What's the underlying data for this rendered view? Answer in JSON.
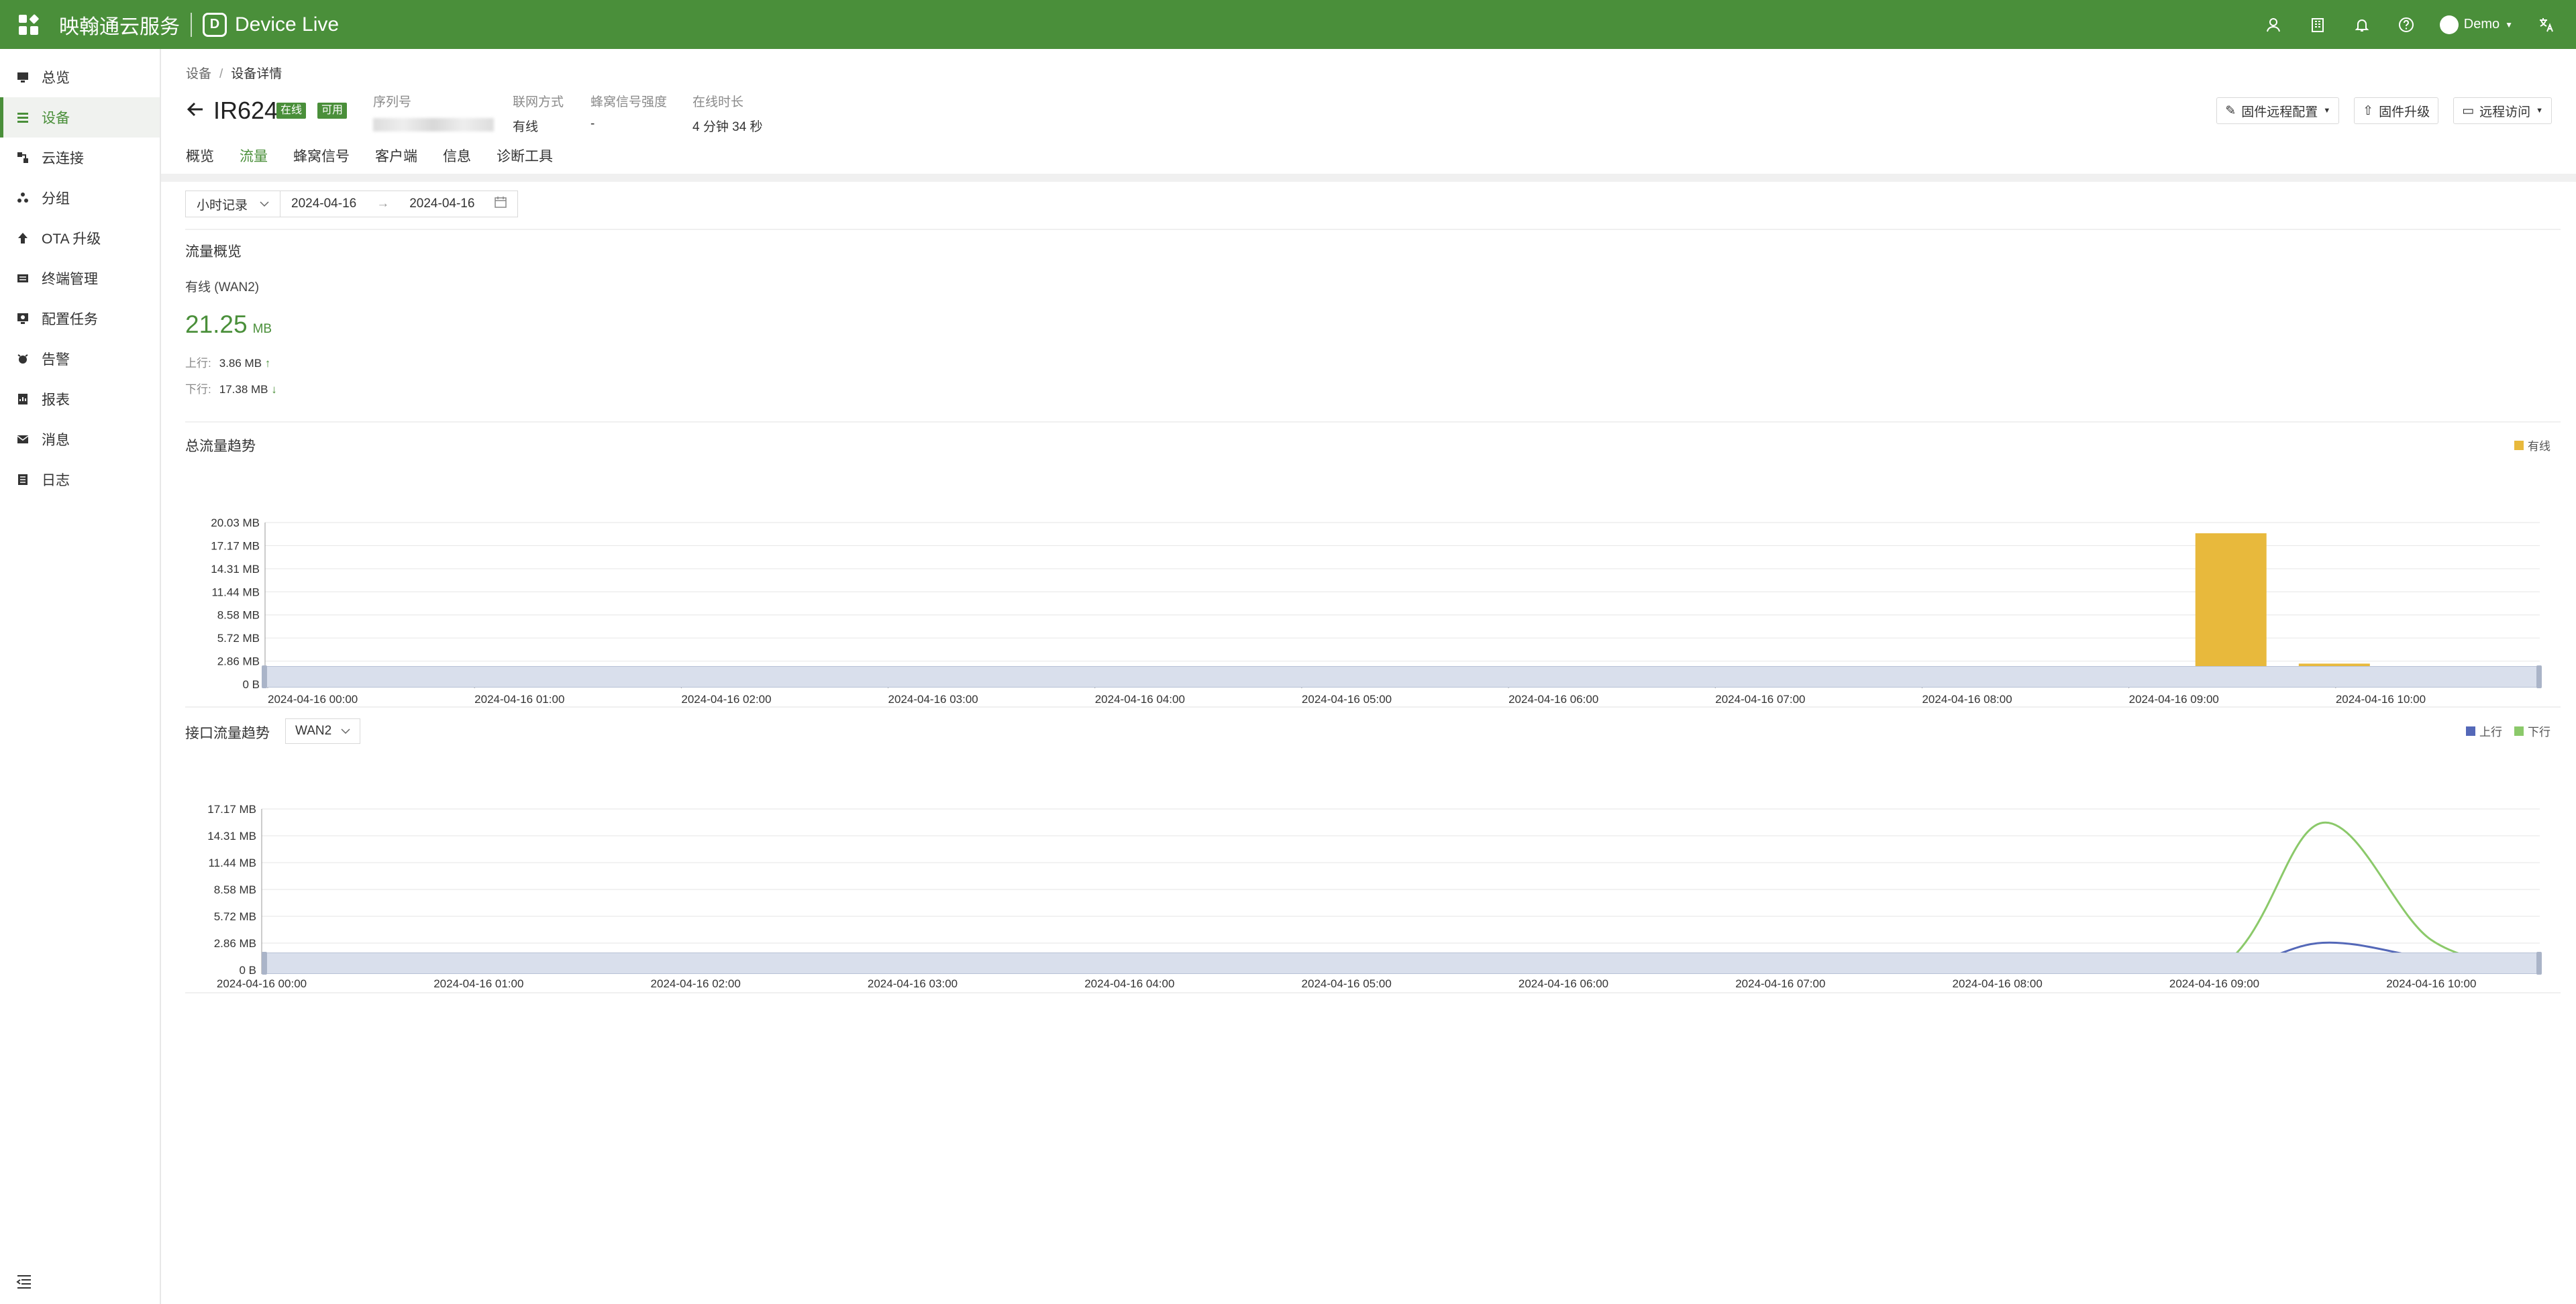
{
  "topbar": {
    "brand": "映翰通云服务",
    "product_logo": "D",
    "product_name": "Device Live",
    "user": "Demo",
    "icons": [
      "user-icon",
      "building-icon",
      "bell-icon",
      "help-icon",
      "translate-icon"
    ]
  },
  "sidebar": {
    "items": [
      {
        "label": "总览",
        "icon": "dashboard-icon"
      },
      {
        "label": "设备",
        "icon": "list-icon",
        "active": true
      },
      {
        "label": "云连接",
        "icon": "connection-icon"
      },
      {
        "label": "分组",
        "icon": "group-icon"
      },
      {
        "label": "OTA 升级",
        "icon": "upload-icon"
      },
      {
        "label": "终端管理",
        "icon": "terminal-icon"
      },
      {
        "label": "配置任务",
        "icon": "config-icon"
      },
      {
        "label": "告警",
        "icon": "alarm-icon"
      },
      {
        "label": "报表",
        "icon": "report-icon"
      },
      {
        "label": "消息",
        "icon": "message-icon"
      },
      {
        "label": "日志",
        "icon": "log-icon"
      }
    ]
  },
  "breadcrumb": {
    "root": "设备",
    "sep": "/",
    "current": "设备详情"
  },
  "device": {
    "name": "IR624",
    "badge_online": "在线",
    "badge_available": "可用",
    "serial_label": "序列号",
    "conn_label": "联网方式",
    "conn_value": "有线",
    "signal_label": "蜂窝信号强度",
    "signal_value": "-",
    "uptime_label": "在线时长",
    "uptime_value": "4 分钟 34 秒"
  },
  "actions": {
    "remote_config": "固件远程配置",
    "firmware_upgrade": "固件升级",
    "remote_access": "远程访问"
  },
  "tabs": [
    "概览",
    "流量",
    "蜂窝信号",
    "客户端",
    "信息",
    "诊断工具"
  ],
  "active_tab": 1,
  "filter": {
    "granularity": "小时记录",
    "date_start": "2024-04-16",
    "date_arrow": "→",
    "date_end": "2024-04-16"
  },
  "overview": {
    "title": "流量概览",
    "wan_label": "有线 (WAN2)",
    "total_value": "21.25",
    "total_unit": "MB",
    "up_label": "上行:",
    "up_value": "3.86 MB",
    "down_label": "下行:",
    "down_value": "17.38 MB"
  },
  "total_chart_title": "总流量趋势",
  "iface_chart_title": "接口流量趋势",
  "iface_select": "WAN2",
  "colors": {
    "brand": "#4a8f3a",
    "bar": "#e8b93c",
    "up": "#5468b8",
    "down": "#8bc96a"
  },
  "chart_data": [
    {
      "type": "bar",
      "title": "总流量趋势",
      "legend": [
        "有线"
      ],
      "y_ticks": [
        "0 B",
        "2.86 MB",
        "5.72 MB",
        "8.58 MB",
        "11.44 MB",
        "14.31 MB",
        "17.17 MB",
        "20.03 MB"
      ],
      "ylim": [
        0,
        20.03
      ],
      "x_ticks": [
        "2024-04-16 00:00",
        "2024-04-16 01:00",
        "2024-04-16 02:00",
        "2024-04-16 03:00",
        "2024-04-16 04:00",
        "2024-04-16 05:00",
        "2024-04-16 06:00",
        "2024-04-16 07:00",
        "2024-04-16 08:00",
        "2024-04-16 09:00",
        "2024-04-16 10:00"
      ],
      "series": [
        {
          "name": "有线",
          "points": [
            {
              "x": 9.5,
              "y": 18.7
            },
            {
              "x": 10.0,
              "y": 2.55
            }
          ]
        }
      ]
    },
    {
      "type": "line",
      "title": "接口流量趋势",
      "legend": [
        "上行",
        "下行"
      ],
      "y_ticks": [
        "0 B",
        "2.86 MB",
        "5.72 MB",
        "8.58 MB",
        "11.44 MB",
        "14.31 MB",
        "17.17 MB"
      ],
      "ylim": [
        0,
        17.17
      ],
      "x_ticks": [
        "2024-04-16 00:00",
        "2024-04-16 01:00",
        "2024-04-16 02:00",
        "2024-04-16 03:00",
        "2024-04-16 04:00",
        "2024-04-16 05:00",
        "2024-04-16 06:00",
        "2024-04-16 07:00",
        "2024-04-16 08:00",
        "2024-04-16 09:00",
        "2024-04-16 10:00"
      ],
      "series": [
        {
          "name": "上行",
          "x": [
            0,
            1,
            2,
            3,
            4,
            5,
            6,
            7,
            8,
            9,
            9.5,
            10,
            10.5
          ],
          "y": [
            0,
            0,
            0,
            0,
            0,
            0,
            0,
            0,
            0,
            0,
            2.9,
            1.2,
            0
          ]
        },
        {
          "name": "下行",
          "x": [
            0,
            1,
            2,
            3,
            4,
            5,
            6,
            7,
            8,
            9,
            9.5,
            10,
            10.5
          ],
          "y": [
            0,
            0,
            0,
            0,
            0,
            0,
            0,
            0,
            0,
            0,
            15.7,
            3.2,
            0
          ]
        }
      ]
    }
  ]
}
